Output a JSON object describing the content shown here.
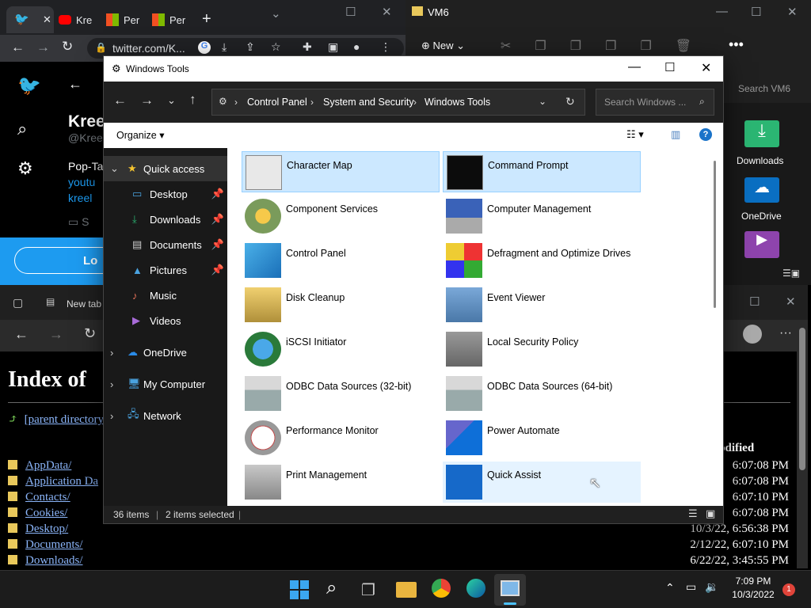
{
  "chrome": {
    "tabs": [
      {
        "label": "Kre"
      },
      {
        "label": "Kre"
      },
      {
        "label": "Per"
      },
      {
        "label": "Per"
      }
    ],
    "url": "twitter.com/K...",
    "profile_name": "Kree",
    "profile_handle": "@Kree",
    "bio_line": "Pop-Ta",
    "link1": "youtu",
    "link2": "kreel",
    "meta": "S",
    "login_label": "Lo"
  },
  "vm6": {
    "title": "VM6",
    "new_label": "New",
    "search_placeholder": "Search VM6",
    "items": [
      {
        "label": "Downloads"
      },
      {
        "label": "OneDrive"
      }
    ]
  },
  "edge": {
    "tab_label": "New tab",
    "heading": "Index of",
    "parent": "[parent directory]",
    "modified_header": "odified",
    "rows": [
      {
        "name": "AppData/",
        "date": "6:07:08 PM"
      },
      {
        "name": "Application Da",
        "date": "6:07:08 PM"
      },
      {
        "name": "Contacts/",
        "date": "6:07:10 PM"
      },
      {
        "name": "Cookies/",
        "date": "6:07:08 PM"
      },
      {
        "name": "Desktop/",
        "date": "10/3/22, 6:56:38 PM"
      },
      {
        "name": "Documents/",
        "date": "2/12/22, 6:07:10 PM"
      },
      {
        "name": "Downloads/",
        "date": "6/22/22, 3:45:55 PM"
      }
    ]
  },
  "explorer": {
    "title": "Windows Tools",
    "breadcrumb": [
      "Control Panel",
      "System and Security",
      "Windows Tools"
    ],
    "search_placeholder": "Search Windows ...",
    "organize": "Organize",
    "nav": {
      "quick_access": "Quick access",
      "pinned": [
        "Desktop",
        "Downloads",
        "Documents",
        "Pictures"
      ],
      "unpinned": [
        "Music",
        "Videos"
      ],
      "onedrive": "OneDrive",
      "my_computer": "My Computer",
      "network": "Network"
    },
    "items": [
      {
        "label": "Character Map",
        "icon": "charmap-icon",
        "selected": true
      },
      {
        "label": "Command Prompt",
        "icon": "cmd-icon",
        "selected": true
      },
      {
        "label": "Component Services",
        "icon": "component-services-icon"
      },
      {
        "label": "Computer Management",
        "icon": "computer-management-icon"
      },
      {
        "label": "Control Panel",
        "icon": "control-panel-icon"
      },
      {
        "label": "Defragment and Optimize Drives",
        "icon": "defrag-icon"
      },
      {
        "label": "Disk Cleanup",
        "icon": "disk-cleanup-icon"
      },
      {
        "label": "Event Viewer",
        "icon": "event-viewer-icon"
      },
      {
        "label": "iSCSI Initiator",
        "icon": "iscsi-icon"
      },
      {
        "label": "Local Security Policy",
        "icon": "security-policy-icon"
      },
      {
        "label": "ODBC Data Sources (32-bit)",
        "icon": "odbc-icon"
      },
      {
        "label": "ODBC Data Sources (64-bit)",
        "icon": "odbc-icon"
      },
      {
        "label": "Performance Monitor",
        "icon": "performance-monitor-icon"
      },
      {
        "label": "Power Automate",
        "icon": "power-automate-icon"
      },
      {
        "label": "Print Management",
        "icon": "print-management-icon"
      },
      {
        "label": "Quick Assist",
        "icon": "quick-assist-icon",
        "hover": true
      }
    ],
    "status": {
      "count": "36 items",
      "selected": "2 items selected"
    }
  },
  "taskbar": {
    "time": "7:09 PM",
    "date": "10/3/2022",
    "badge": "1"
  },
  "colors": {
    "accent": "#0078d4",
    "selection": "#cce8ff",
    "twitter": "#1d9bf0"
  }
}
